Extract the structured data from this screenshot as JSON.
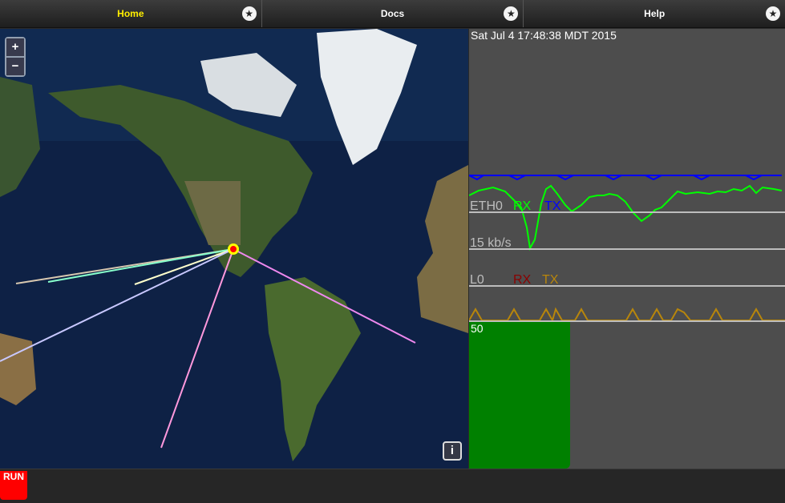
{
  "nav": {
    "tabs": [
      {
        "label": "Home",
        "active": true
      },
      {
        "label": "Docs",
        "active": false
      },
      {
        "label": "Help",
        "active": false
      }
    ],
    "star_glyph": "★"
  },
  "map": {
    "zoom_in": "+",
    "zoom_out": "−",
    "info": "i"
  },
  "status": {
    "datetime": "Sat Jul 4 17:48:38 MDT 2015",
    "eth_label": "ETH0",
    "rx_label": "RX",
    "tx_label": "TX",
    "rate_label": "15 kb/s",
    "load_label": "L0",
    "load_rx_label": "RX",
    "load_tx_label": "TX",
    "bar_value": "50",
    "bar_level_percent": 50
  },
  "bottom": {
    "run_label": "RUN"
  },
  "colors": {
    "active_tab": "#ffee00",
    "rx_green": "#00ff00",
    "tx_blue": "#0000ff",
    "load_rx": "#8b0000",
    "load_tx": "#b8860b",
    "bar_green": "#008000",
    "run_red": "#ff0000"
  }
}
